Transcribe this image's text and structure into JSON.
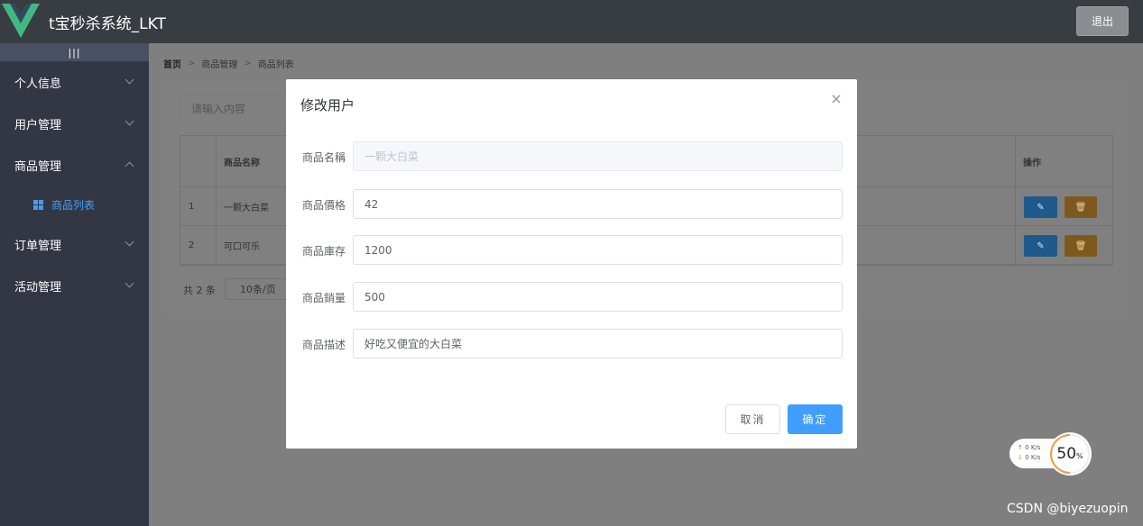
{
  "header": {
    "app_title": "t宝秒杀系统_LKT",
    "logout_label": "退出",
    "brand_color": "#41b883"
  },
  "sidebar": {
    "toggle_label": "|||",
    "items": [
      {
        "label": "个人信息"
      },
      {
        "label": "用户管理"
      },
      {
        "label": "商品管理",
        "expanded": true
      },
      {
        "label": "订单管理"
      },
      {
        "label": "活动管理"
      }
    ],
    "active_subitem": {
      "label": "商品列表",
      "icon": "grid-icon"
    }
  },
  "breadcrumb": [
    "首页",
    "商品管理",
    "商品列表"
  ],
  "list": {
    "search_placeholder": "请输入内容",
    "columns": [
      "",
      "商品名称",
      "操作"
    ],
    "rows": [
      {
        "index": "1",
        "name": "一颗大白菜"
      },
      {
        "index": "2",
        "name": "可口可乐"
      }
    ],
    "edit_icon": "edit-icon",
    "delete_icon": "trash-icon",
    "pager_total": "共 2 条",
    "pager_size": "10条/页"
  },
  "dialog": {
    "title": "修改用户",
    "fields": [
      {
        "label": "商品名稱",
        "value": "一颗大白菜",
        "disabled": true
      },
      {
        "label": "商品價格",
        "value": "42"
      },
      {
        "label": "商品庫存",
        "value": "1200"
      },
      {
        "label": "商品銷量",
        "value": "500"
      },
      {
        "label": "商品描述",
        "value": "好吃又便宜的大白菜"
      }
    ],
    "cancel_label": "取消",
    "confirm_label": "确定"
  },
  "speed_widget": {
    "up_value": "0",
    "down_value": "0",
    "unit": "K/s",
    "percent": "50",
    "percent_sign": "%"
  },
  "watermark": "CSDN @biyezuopin"
}
